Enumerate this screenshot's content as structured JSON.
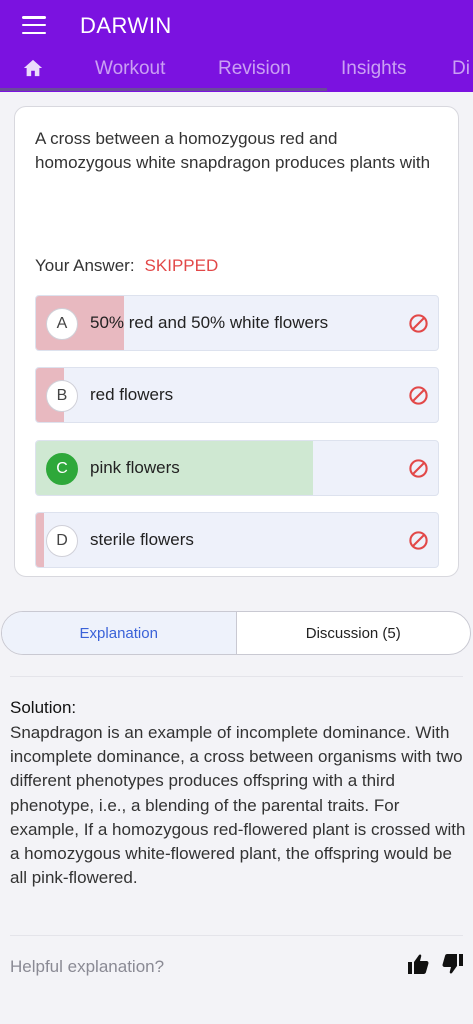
{
  "header": {
    "title": "DARWIN",
    "menu_icon": "hamburger-menu-icon"
  },
  "tabs": [
    {
      "label": "Workout"
    },
    {
      "label": "Revision"
    },
    {
      "label": "Insights"
    },
    {
      "label": "Di"
    }
  ],
  "question": {
    "text": "A cross between a homozygous red and homozygous white snapdragon produces plants with",
    "your_answer_label": "Your Answer:",
    "your_answer_value": "SKIPPED"
  },
  "options": [
    {
      "letter": "A",
      "text": "50% red and 50% white flowers",
      "selected_fraction": 0.22,
      "correct": false
    },
    {
      "letter": "B",
      "text": "red flowers",
      "selected_fraction": 0.07,
      "correct": false
    },
    {
      "letter": "C",
      "text": "pink flowers",
      "selected_fraction": 0.69,
      "correct": true
    },
    {
      "letter": "D",
      "text": "sterile flowers",
      "selected_fraction": 0.02,
      "correct": false
    }
  ],
  "colors": {
    "brand": "#7b12e0",
    "wrong": "#e8b9c0",
    "correct": "#cfe8d2",
    "skipped": "#e24848",
    "accent": "#3a62d8"
  },
  "segments": {
    "explanation": "Explanation",
    "discussion": "Discussion (5)"
  },
  "solution": {
    "label": "Solution:",
    "text": "Snapdragon is an example of incomplete dominance. With incomplete dominance, a cross between organisms with two different phenotypes produces offspring with a third phenotype, i.e., a blending of the parental traits. For example, If a homozygous red-flowered plant is crossed with a homozygous white-flowered plant, the offspring would be all pink-flowered."
  },
  "feedback": {
    "label": "Helpful explanation?"
  }
}
